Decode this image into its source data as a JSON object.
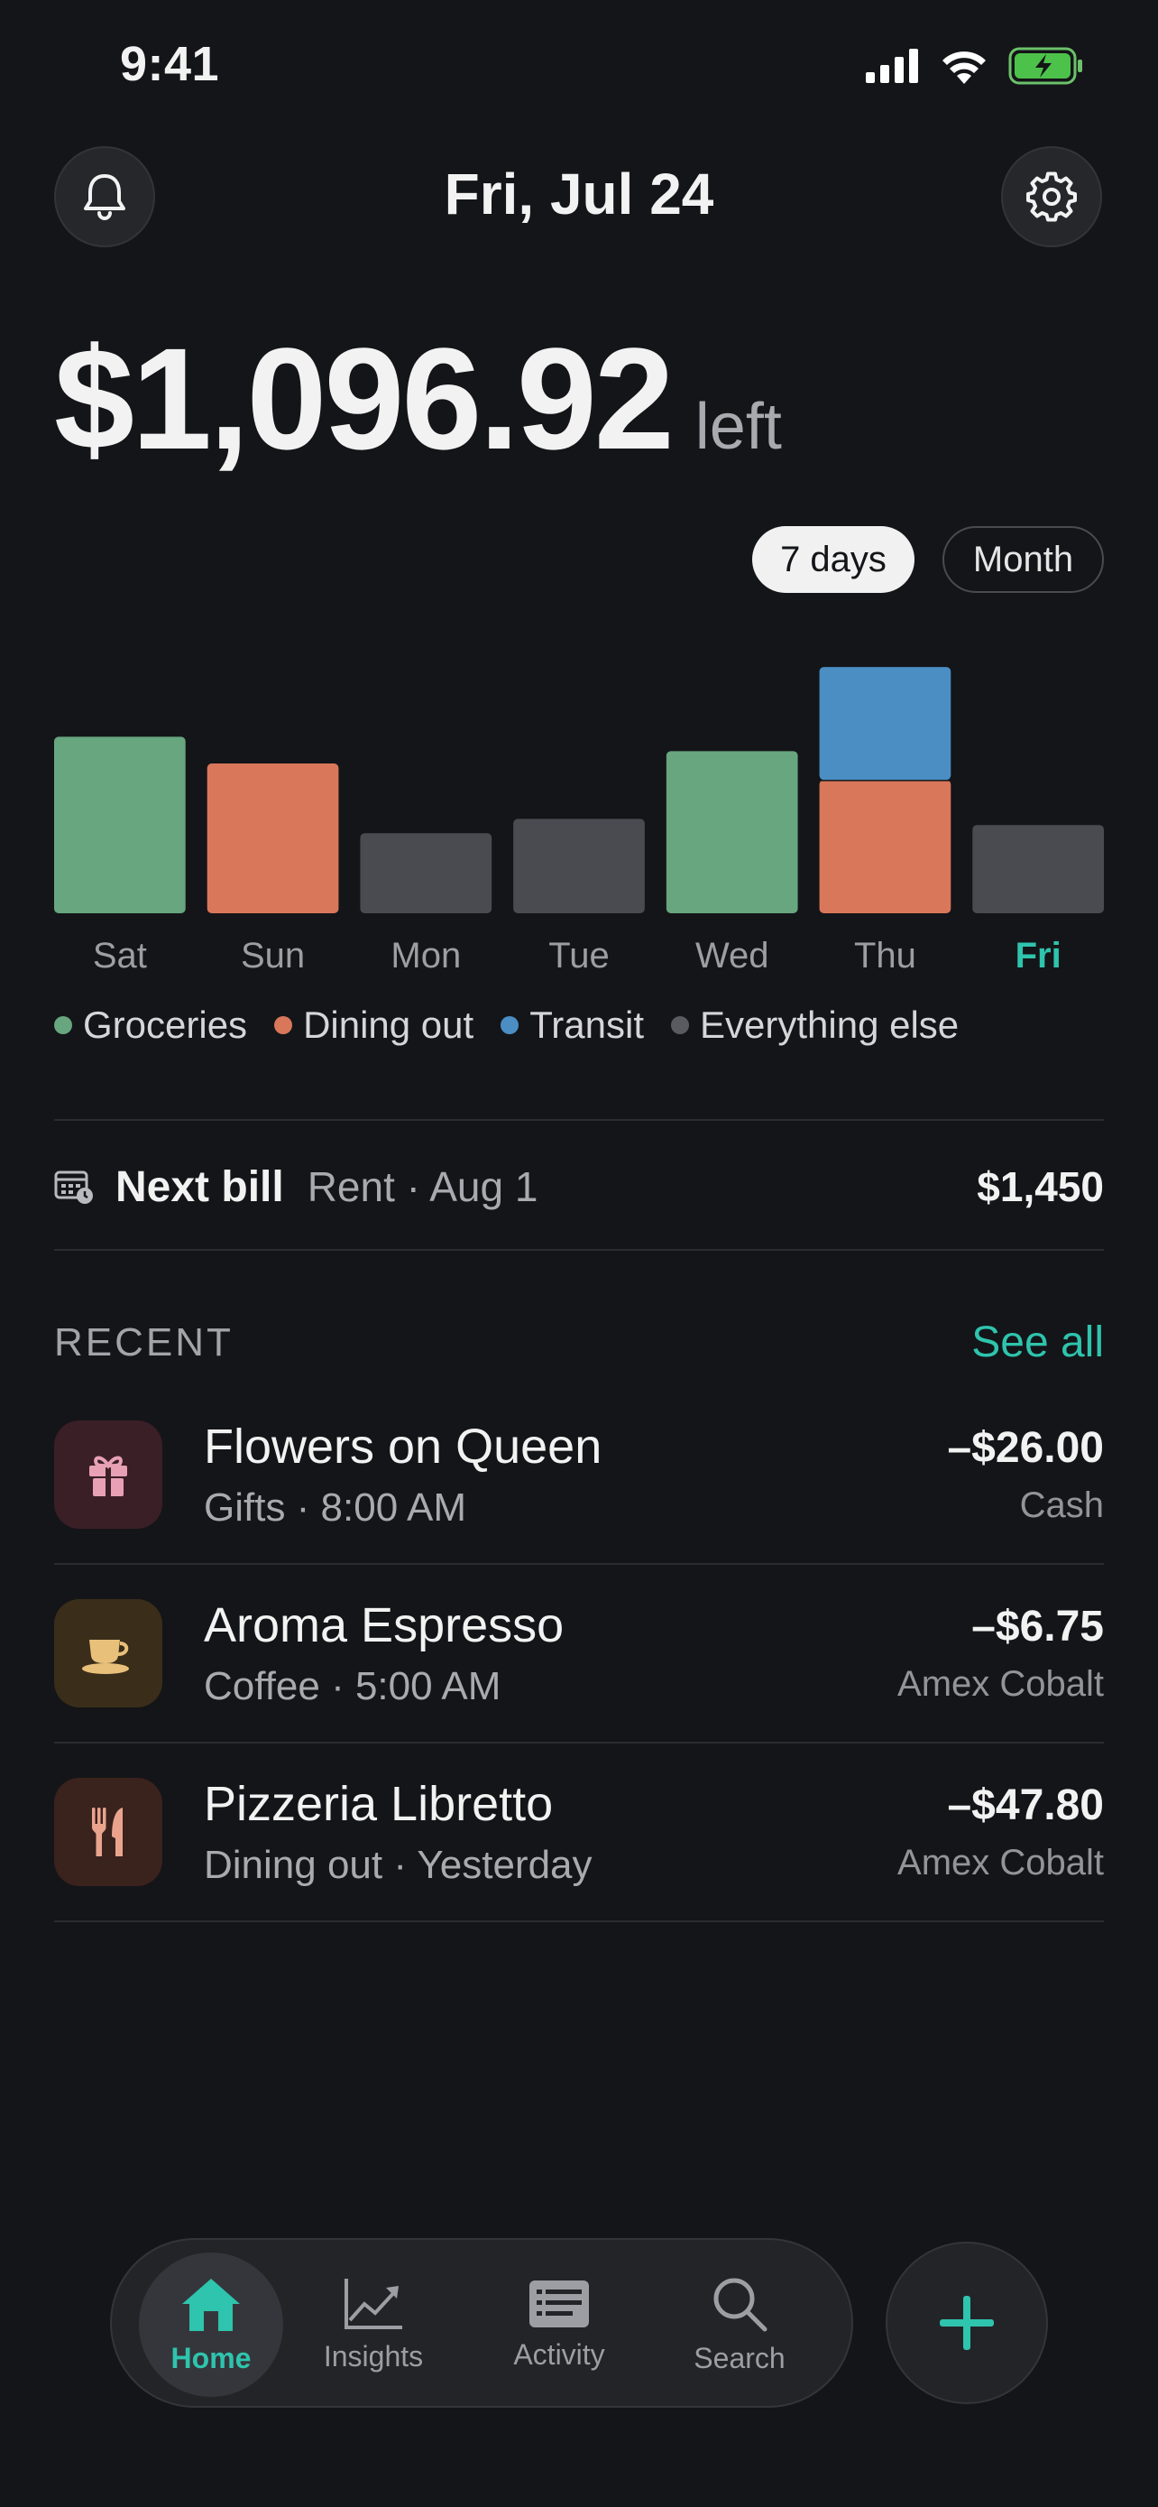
{
  "status": {
    "time": "9:41"
  },
  "header": {
    "title": "Fri, Jul 24"
  },
  "balance": {
    "amount": "$1,096.92",
    "suffix": "left"
  },
  "range": {
    "options": [
      "7 days",
      "Month"
    ],
    "selected": "7 days"
  },
  "chart_data": {
    "type": "bar",
    "stacked": true,
    "categories": [
      "Sat",
      "Sun",
      "Mon",
      "Tue",
      "Wed",
      "Thu",
      "Fri"
    ],
    "highlight_category": "Fri",
    "series": [
      {
        "name": "Groceries",
        "color": "#67a67f",
        "values": [
          4.3,
          0,
          0,
          0,
          3.95,
          0,
          0
        ]
      },
      {
        "name": "Dining out",
        "color": "#d9775b",
        "values": [
          0,
          3.65,
          0,
          0,
          0,
          3.25,
          0
        ]
      },
      {
        "name": "Transit",
        "color": "#4a8ec4",
        "values": [
          0,
          0,
          0,
          0,
          0,
          2.75,
          0
        ]
      },
      {
        "name": "Everything else",
        "color": "#4a4b50",
        "values": [
          0,
          0,
          1.95,
          2.3,
          0,
          0,
          2.15
        ]
      }
    ],
    "ylim": [
      0,
      6.2
    ],
    "grid": false,
    "legend_position": "bottom"
  },
  "next_bill": {
    "label": "Next bill",
    "detail": "Rent · Aug 1",
    "amount": "$1,450"
  },
  "recent": {
    "title": "RECENT",
    "see_all": "See all",
    "items": [
      {
        "name": "Flowers on Queen",
        "sub": "Gifts · 8:00 AM",
        "amount": "–$26.00",
        "method": "Cash",
        "icon": "gift-icon",
        "icon_bg": "#3a1f26",
        "icon_color": "#e8a1b4"
      },
      {
        "name": "Aroma Espresso",
        "sub": "Coffee · 5:00 AM",
        "amount": "–$6.75",
        "method": "Amex Cobalt",
        "icon": "coffee-icon",
        "icon_bg": "#3a2e1a",
        "icon_color": "#e9c07a"
      },
      {
        "name": "Pizzeria Libretto",
        "sub": "Dining out · Yesterday",
        "amount": "–$47.80",
        "method": "Amex Cobalt",
        "icon": "utensils-icon",
        "icon_bg": "#3a221d",
        "icon_color": "#eaa48e"
      }
    ]
  },
  "tabs": [
    {
      "label": "Home",
      "icon": "home-icon",
      "active": true
    },
    {
      "label": "Insights",
      "icon": "chart-icon",
      "active": false
    },
    {
      "label": "Activity",
      "icon": "list-icon",
      "active": false
    },
    {
      "label": "Search",
      "icon": "search-icon",
      "active": false
    }
  ],
  "colors": {
    "accent": "#2ec4ad",
    "background": "#141518"
  }
}
